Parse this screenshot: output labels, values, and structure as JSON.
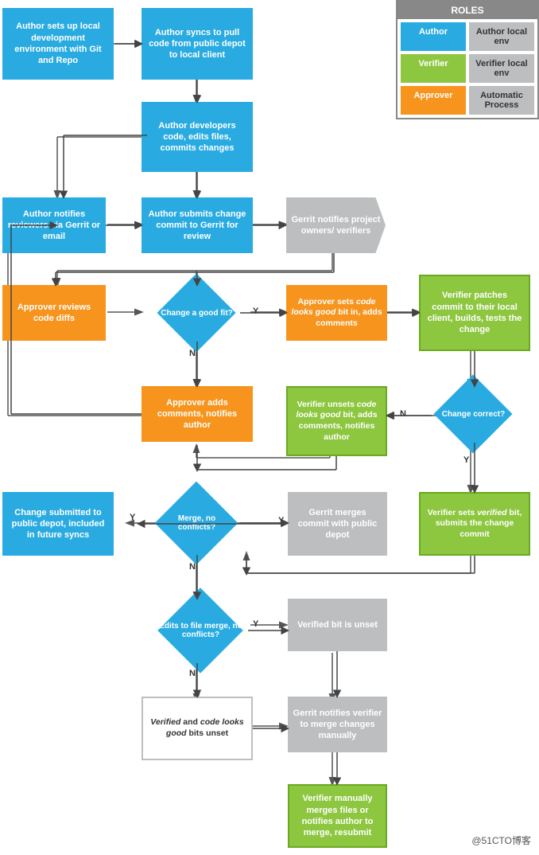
{
  "roles": {
    "title": "ROLES",
    "items": [
      {
        "label": "Author",
        "type": "blue"
      },
      {
        "label": "Author local env",
        "type": "gray"
      },
      {
        "label": "Verifier",
        "type": "green"
      },
      {
        "label": "Verifier local env",
        "type": "gray"
      },
      {
        "label": "Approver",
        "type": "orange"
      },
      {
        "label": "Automatic Process",
        "type": "gray-border"
      }
    ]
  },
  "nodes": {
    "n1": "Author sets up local development environment with Git and Repo",
    "n2": "Author syncs to pull code from public depot to local client",
    "n3": "Author developers code, edits files, commits changes",
    "n4": "Author notifies reviewers via Gerrit or email",
    "n5": "Author submits change commit to Gerrit for review",
    "n6": "Gerrit notifies project owners/ verifiers",
    "n7": "Approver reviews code diffs",
    "n8_diamond": "Change a good fit?",
    "n9": "Approver sets code looks good bit in, adds comments",
    "n10": "Verifier patches commit to their local client, builds, tests the change",
    "n11": "Approver adds comments, notifies author",
    "n12": "Verifier unsets code looks good bit, adds comments, notifies author",
    "n12_diamond": "Change correct?",
    "n13": "Change submitted to public depot, included in future syncs",
    "n14_diamond": "Merge, no conflicts?",
    "n15": "Gerrit merges commit with public depot",
    "n16": "Verifier sets verified bit, submits the change commit",
    "n17_diamond": "Edits to file merge, no conflicts?",
    "n18": "Verified bit is unset",
    "n19": "Verified and code looks good bits unset",
    "n20": "Gerrit notifies verifier to merge changes manually",
    "n21": "Verifier manually merges files or notifies author to merge, resubmit"
  },
  "watermark": "@51CTO博客"
}
